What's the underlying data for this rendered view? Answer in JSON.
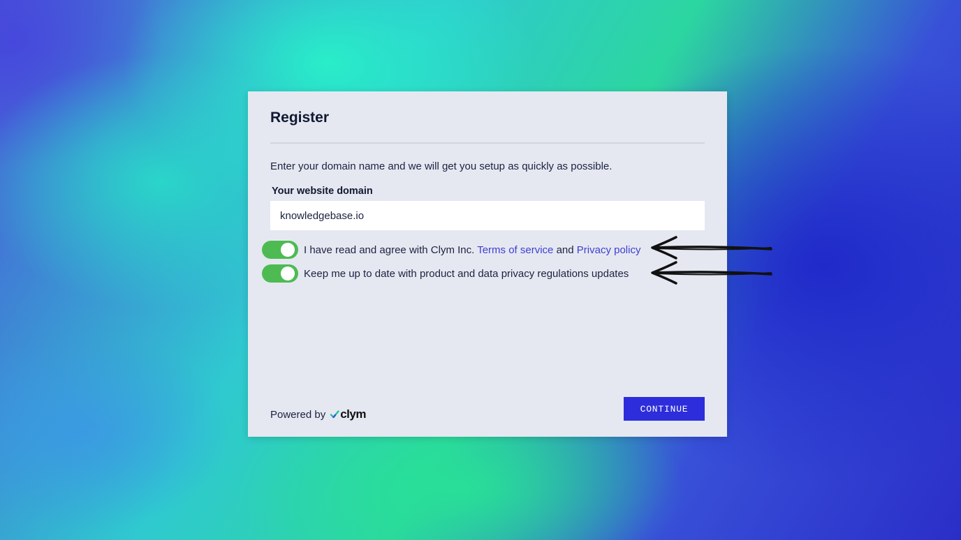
{
  "dialog": {
    "title": "Register",
    "intro": "Enter your domain name and we will get you setup as quickly as possible.",
    "domain_label": "Your website domain",
    "domain_value": "knowledgebase.io",
    "terms": {
      "checked": true,
      "text_before": "I have read and agree with Clym Inc.",
      "terms_link": "Terms of service",
      "and_text": "and",
      "privacy_link": "Privacy policy"
    },
    "updates": {
      "checked": true,
      "text": "Keep me up to date with product and data privacy regulations updates"
    },
    "powered_by": "Powered by",
    "logo_text": "clym",
    "continue_label": "CONTINUE"
  },
  "colors": {
    "card_bg": "#e5e8f1",
    "toggle_on": "#4dbb52",
    "link": "#3f3fd0",
    "button": "#2d2ddb"
  },
  "icons": {
    "logo_mark": "checkmark-icon",
    "annotation": "arrow-left-icon"
  }
}
